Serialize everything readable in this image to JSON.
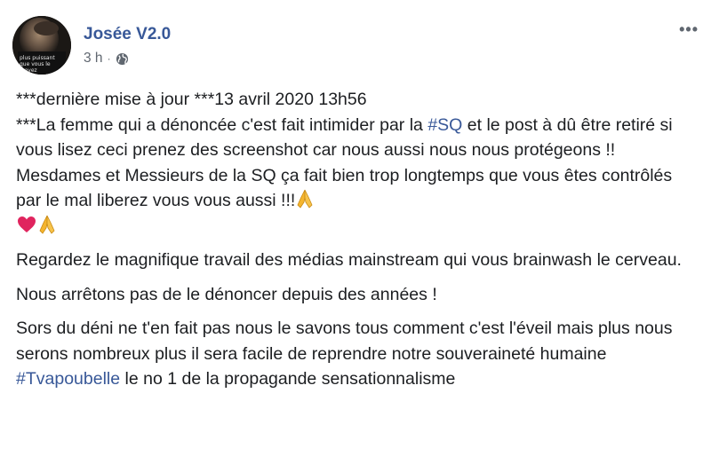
{
  "post": {
    "author": "Josée V2.0",
    "timestamp": "3 h",
    "separator": "·",
    "privacy_icon": "globe-icon",
    "more_icon": "ellipsis-icon",
    "avatar_text": "plus puissant que vous le croyez",
    "paragraphs": {
      "p1": {
        "line1": "***dernière mise à jour ***13 avril 2020 13h56",
        "line2_pre": "***La femme qui a dénoncée c'est fait intimider par la ",
        "hashtag_sq": "#SQ",
        "line2_post": " et le post à dû être retiré si vous lisez ceci prenez des screenshot car nous aussi nous nous protégeons !! Mesdames et Messieurs de la SQ ça fait bien trop longtemps que vous êtes contrôlés par le mal liberez vous vous aussi !!!"
      },
      "p2": "Regardez le magnifique travail des médias mainstream qui vous brainwash le cerveau.",
      "p3": "Nous arrêtons pas de le dénoncer depuis des années !",
      "p4": {
        "text": "Sors du déni ne t'en fait pas nous le savons tous comment c'est l'éveil mais plus nous serons nombreux plus il sera facile de reprendre notre souveraineté humaine",
        "hashtag": "#Tvapoubelle",
        "hashtag_tail": " le no 1 de la propagande sensationnalisme"
      }
    },
    "emojis": [
      "praying-hands-icon",
      "red-heart-icon",
      "praying-hands-icon"
    ],
    "colors": {
      "link": "#385898",
      "text": "#1c1e21",
      "meta": "#606770",
      "heart": "#e0245e",
      "hands": "#f5b52e"
    }
  }
}
